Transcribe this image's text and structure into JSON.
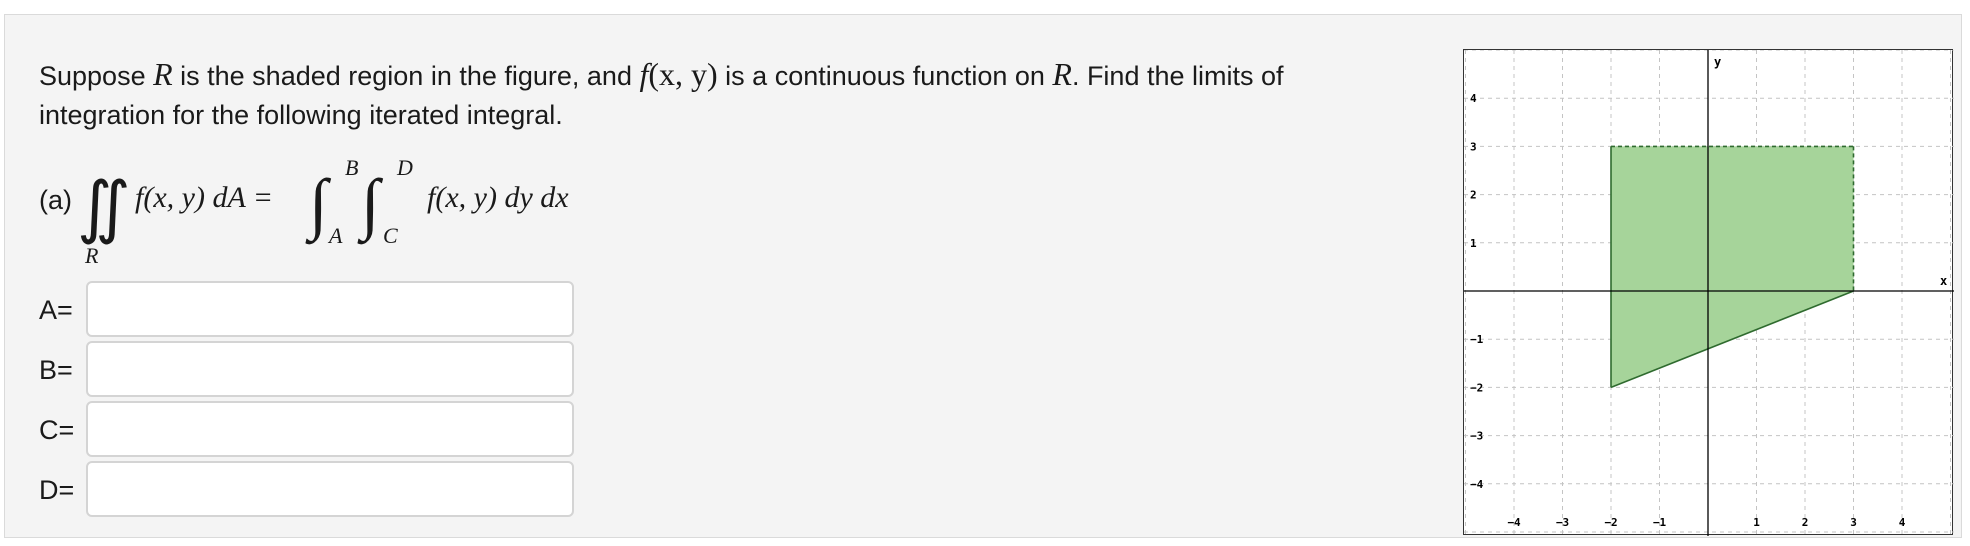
{
  "question": {
    "t1": "Suppose ",
    "R": "R",
    "t2": " is the shaded region in the figure, and ",
    "f": "f",
    "args": "(x, y)",
    "t3": " is a continuous function on ",
    "t4": ". Find the limits of integration for the following iterated integral."
  },
  "part": {
    "label": "(a)",
    "lhs_region": "R",
    "lhs_integrand": "f(x, y) dA =",
    "upper_outer": "B",
    "lower_outer": "A",
    "upper_inner": "D",
    "lower_inner": "C",
    "rhs_integrand": "f(x, y) dy dx"
  },
  "fields": [
    {
      "label": "A=",
      "value": ""
    },
    {
      "label": "B=",
      "value": ""
    },
    {
      "label": "C=",
      "value": ""
    },
    {
      "label": "D=",
      "value": ""
    }
  ],
  "graph": {
    "x_label": "x",
    "y_label": "y",
    "x_range": [
      -5,
      5
    ],
    "y_range": [
      -5,
      5
    ],
    "x_ticks": [
      -4,
      -3,
      -2,
      -1,
      1,
      2,
      3,
      4
    ],
    "y_ticks": [
      -4,
      -3,
      -2,
      -1,
      1,
      2,
      3,
      4
    ],
    "region_vertices": [
      [
        -2,
        -2
      ],
      [
        -2,
        3
      ],
      [
        3,
        3
      ],
      [
        3,
        0
      ]
    ],
    "fill_color": "#a6d49a",
    "edge_color": "#2f6b2f",
    "grid": true
  }
}
